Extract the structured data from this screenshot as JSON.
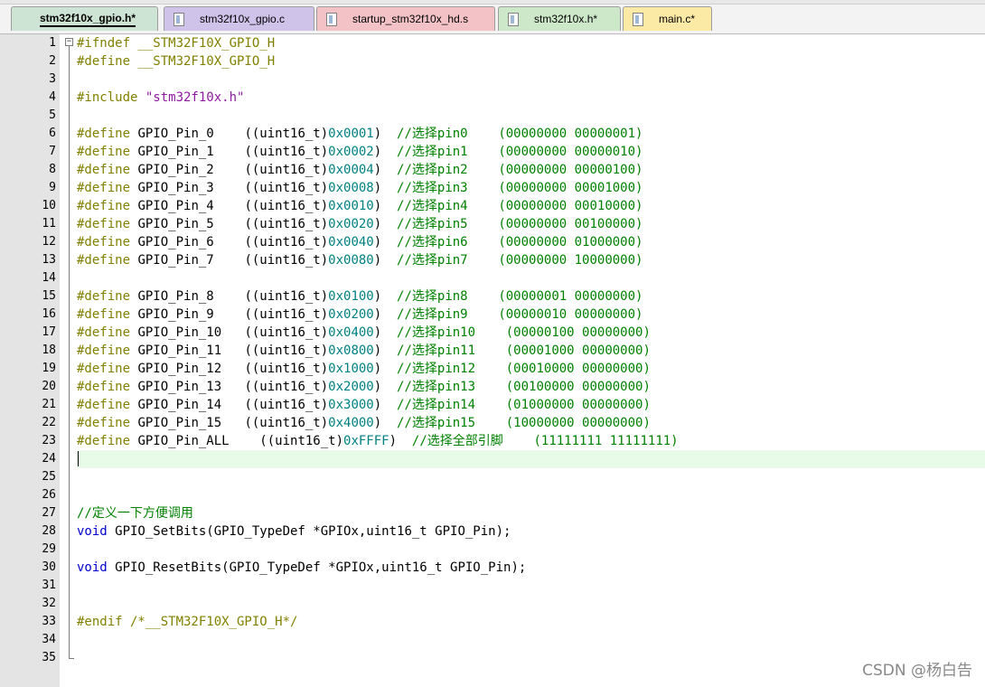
{
  "tabs": [
    {
      "label": "stm32f10x_gpio.h*",
      "color": "#cde3d4",
      "active": true
    },
    {
      "label": "stm32f10x_gpio.c",
      "color": "#cfc3e9",
      "active": false
    },
    {
      "label": "startup_stm32f10x_hd.s",
      "color": "#f3c2c6",
      "active": false
    },
    {
      "label": "stm32f10x.h*",
      "color": "#cde7c9",
      "active": false
    },
    {
      "label": "main.c*",
      "color": "#fbe9a6",
      "active": false
    }
  ],
  "editor": {
    "current_line": 24,
    "lines": [
      [
        {
          "t": "#ifndef __STM32F10X_GPIO_H",
          "c": "pp"
        }
      ],
      [
        {
          "t": "#define __STM32F10X_GPIO_H",
          "c": "pp"
        }
      ],
      [],
      [
        {
          "t": "#include ",
          "c": "pp"
        },
        {
          "t": "\"stm32f10x.h\"",
          "c": "strp"
        }
      ],
      [],
      [
        {
          "t": "#define ",
          "c": "pp"
        },
        {
          "t": "GPIO_Pin_0    ((uint16_t)",
          "c": "pun"
        },
        {
          "t": "0x0001",
          "c": "num"
        },
        {
          "t": ")  ",
          "c": "pun"
        },
        {
          "t": "//选择pin0    (00000000 00000001)",
          "c": "cmt"
        }
      ],
      [
        {
          "t": "#define ",
          "c": "pp"
        },
        {
          "t": "GPIO_Pin_1    ((uint16_t)",
          "c": "pun"
        },
        {
          "t": "0x0002",
          "c": "num"
        },
        {
          "t": ")  ",
          "c": "pun"
        },
        {
          "t": "//选择pin1    (00000000 00000010)",
          "c": "cmt"
        }
      ],
      [
        {
          "t": "#define ",
          "c": "pp"
        },
        {
          "t": "GPIO_Pin_2    ((uint16_t)",
          "c": "pun"
        },
        {
          "t": "0x0004",
          "c": "num"
        },
        {
          "t": ")  ",
          "c": "pun"
        },
        {
          "t": "//选择pin2    (00000000 00000100)",
          "c": "cmt"
        }
      ],
      [
        {
          "t": "#define ",
          "c": "pp"
        },
        {
          "t": "GPIO_Pin_3    ((uint16_t)",
          "c": "pun"
        },
        {
          "t": "0x0008",
          "c": "num"
        },
        {
          "t": ")  ",
          "c": "pun"
        },
        {
          "t": "//选择pin3    (00000000 00001000)",
          "c": "cmt"
        }
      ],
      [
        {
          "t": "#define ",
          "c": "pp"
        },
        {
          "t": "GPIO_Pin_4    ((uint16_t)",
          "c": "pun"
        },
        {
          "t": "0x0010",
          "c": "num"
        },
        {
          "t": ")  ",
          "c": "pun"
        },
        {
          "t": "//选择pin4    (00000000 00010000)",
          "c": "cmt"
        }
      ],
      [
        {
          "t": "#define ",
          "c": "pp"
        },
        {
          "t": "GPIO_Pin_5    ((uint16_t)",
          "c": "pun"
        },
        {
          "t": "0x0020",
          "c": "num"
        },
        {
          "t": ")  ",
          "c": "pun"
        },
        {
          "t": "//选择pin5    (00000000 00100000)",
          "c": "cmt"
        }
      ],
      [
        {
          "t": "#define ",
          "c": "pp"
        },
        {
          "t": "GPIO_Pin_6    ((uint16_t)",
          "c": "pun"
        },
        {
          "t": "0x0040",
          "c": "num"
        },
        {
          "t": ")  ",
          "c": "pun"
        },
        {
          "t": "//选择pin6    (00000000 01000000)",
          "c": "cmt"
        }
      ],
      [
        {
          "t": "#define ",
          "c": "pp"
        },
        {
          "t": "GPIO_Pin_7    ((uint16_t)",
          "c": "pun"
        },
        {
          "t": "0x0080",
          "c": "num"
        },
        {
          "t": ")  ",
          "c": "pun"
        },
        {
          "t": "//选择pin7    (00000000 10000000)",
          "c": "cmt"
        }
      ],
      [],
      [
        {
          "t": "#define ",
          "c": "pp"
        },
        {
          "t": "GPIO_Pin_8    ((uint16_t)",
          "c": "pun"
        },
        {
          "t": "0x0100",
          "c": "num"
        },
        {
          "t": ")  ",
          "c": "pun"
        },
        {
          "t": "//选择pin8    (00000001 00000000)",
          "c": "cmt"
        }
      ],
      [
        {
          "t": "#define ",
          "c": "pp"
        },
        {
          "t": "GPIO_Pin_9    ((uint16_t)",
          "c": "pun"
        },
        {
          "t": "0x0200",
          "c": "num"
        },
        {
          "t": ")  ",
          "c": "pun"
        },
        {
          "t": "//选择pin9    (00000010 00000000)",
          "c": "cmt"
        }
      ],
      [
        {
          "t": "#define ",
          "c": "pp"
        },
        {
          "t": "GPIO_Pin_10   ((uint16_t)",
          "c": "pun"
        },
        {
          "t": "0x0400",
          "c": "num"
        },
        {
          "t": ")  ",
          "c": "pun"
        },
        {
          "t": "//选择pin10    (00000100 00000000)",
          "c": "cmt"
        }
      ],
      [
        {
          "t": "#define ",
          "c": "pp"
        },
        {
          "t": "GPIO_Pin_11   ((uint16_t)",
          "c": "pun"
        },
        {
          "t": "0x0800",
          "c": "num"
        },
        {
          "t": ")  ",
          "c": "pun"
        },
        {
          "t": "//选择pin11    (00001000 00000000)",
          "c": "cmt"
        }
      ],
      [
        {
          "t": "#define ",
          "c": "pp"
        },
        {
          "t": "GPIO_Pin_12   ((uint16_t)",
          "c": "pun"
        },
        {
          "t": "0x1000",
          "c": "num"
        },
        {
          "t": ")  ",
          "c": "pun"
        },
        {
          "t": "//选择pin12    (00010000 00000000)",
          "c": "cmt"
        }
      ],
      [
        {
          "t": "#define ",
          "c": "pp"
        },
        {
          "t": "GPIO_Pin_13   ((uint16_t)",
          "c": "pun"
        },
        {
          "t": "0x2000",
          "c": "num"
        },
        {
          "t": ")  ",
          "c": "pun"
        },
        {
          "t": "//选择pin13    (00100000 00000000)",
          "c": "cmt"
        }
      ],
      [
        {
          "t": "#define ",
          "c": "pp"
        },
        {
          "t": "GPIO_Pin_14   ((uint16_t)",
          "c": "pun"
        },
        {
          "t": "0x3000",
          "c": "num"
        },
        {
          "t": ")  ",
          "c": "pun"
        },
        {
          "t": "//选择pin14    (01000000 00000000)",
          "c": "cmt"
        }
      ],
      [
        {
          "t": "#define ",
          "c": "pp"
        },
        {
          "t": "GPIO_Pin_15   ((uint16_t)",
          "c": "pun"
        },
        {
          "t": "0x4000",
          "c": "num"
        },
        {
          "t": ")  ",
          "c": "pun"
        },
        {
          "t": "//选择pin15    (10000000 00000000)",
          "c": "cmt"
        }
      ],
      [
        {
          "t": "#define ",
          "c": "pp"
        },
        {
          "t": "GPIO_Pin_ALL    ((uint16_t)",
          "c": "pun"
        },
        {
          "t": "0xFFFF",
          "c": "num"
        },
        {
          "t": ")  ",
          "c": "pun"
        },
        {
          "t": "//选择全部引脚    (11111111 11111111)",
          "c": "cmt"
        }
      ],
      [],
      [],
      [],
      [
        {
          "t": "//定义一下方便调用",
          "c": "cmt"
        }
      ],
      [
        {
          "t": "void",
          "c": "kw"
        },
        {
          "t": " GPIO_SetBits(GPIO_TypeDef *GPIOx,uint16_t GPIO_Pin);",
          "c": "pun"
        }
      ],
      [],
      [
        {
          "t": "void",
          "c": "kw"
        },
        {
          "t": " GPIO_ResetBits(GPIO_TypeDef *GPIOx,uint16_t GPIO_Pin);",
          "c": "pun"
        }
      ],
      [],
      [],
      [
        {
          "t": "#endif /*__STM32F10X_GPIO_H*/",
          "c": "pp"
        }
      ],
      [],
      []
    ]
  },
  "watermark": "CSDN @杨白告"
}
